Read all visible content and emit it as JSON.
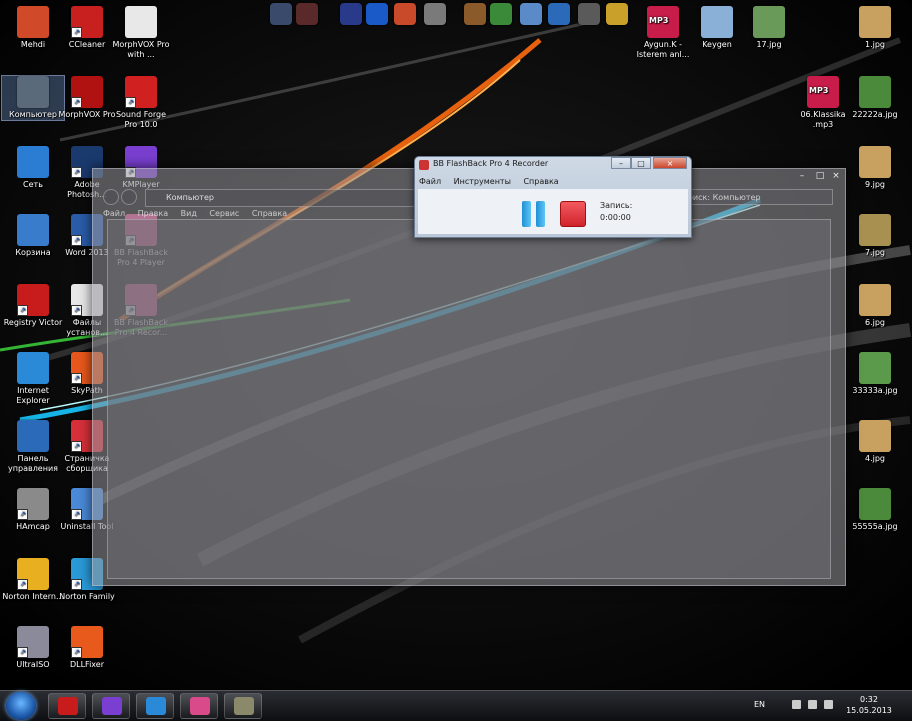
{
  "desktop": {
    "icons_left": [
      {
        "label": "Mehdi",
        "icon": "user-folder-icon",
        "color": "#d04a2a",
        "shortcut": false
      },
      {
        "label": "CCleaner",
        "icon": "ccleaner-icon",
        "color": "#c8201e",
        "shortcut": true
      },
      {
        "label": "MorphVOX Pro with ...",
        "icon": "document-icon",
        "color": "#e8e8e8",
        "shortcut": false
      },
      {
        "label": "Компьютер",
        "icon": "computer-icon",
        "color": "#5a6a7a",
        "shortcut": false,
        "selected": true
      },
      {
        "label": "MorphVOX Pro",
        "icon": "morphvox-icon",
        "color": "#b01212",
        "shortcut": true
      },
      {
        "label": "Sound Forge Pro 10.0",
        "icon": "soundforge-icon",
        "color": "#d02020",
        "shortcut": true
      },
      {
        "label": "Сеть",
        "icon": "network-icon",
        "color": "#2b7cd3",
        "shortcut": false
      },
      {
        "label": "Adobe Photosh...",
        "icon": "photoshop-icon",
        "color": "#1a3a6e",
        "shortcut": true
      },
      {
        "label": "KMPlayer",
        "icon": "kmplayer-icon",
        "color": "#7a3fd0",
        "shortcut": true
      },
      {
        "label": "Корзина",
        "icon": "recycle-bin-icon",
        "color": "#3a7ccc",
        "shortcut": false
      },
      {
        "label": "Word 2013",
        "icon": "word-icon",
        "color": "#2a5caa",
        "shortcut": true
      },
      {
        "label": "BB FlashBack Pro 4 Player",
        "icon": "flashback-player-icon",
        "color": "#d84a8a",
        "shortcut": true
      },
      {
        "label": "Registry Victor",
        "icon": "registry-icon",
        "color": "#c81c1c",
        "shortcut": true
      },
      {
        "label": "Файлы установ...",
        "icon": "files-icon",
        "color": "#e8e8e8",
        "shortcut": true
      },
      {
        "label": "BB FlashBack Pro 4 Recor...",
        "icon": "flashback-recorder-icon",
        "color": "#d84a8a",
        "shortcut": true
      },
      {
        "label": "Internet Explorer",
        "icon": "internet-explorer-icon",
        "color": "#2a8ad8",
        "shortcut": false
      },
      {
        "label": "SkyPath",
        "icon": "skypath-icon",
        "color": "#e8581c",
        "shortcut": true
      },
      {
        "label": "Панель управления",
        "icon": "control-panel-icon",
        "color": "#2a6ab8",
        "shortcut": false
      },
      {
        "label": "Страничка сборщика",
        "icon": "opera-icon",
        "color": "#d8303a",
        "shortcut": true
      },
      {
        "label": "HAmcap",
        "icon": "hamcap-icon",
        "color": "#8a8a8a",
        "shortcut": true
      },
      {
        "label": "Uninstall Tool",
        "icon": "uninstall-icon",
        "color": "#4a8ad8",
        "shortcut": true
      },
      {
        "label": "Norton Intern...",
        "icon": "norton-icon",
        "color": "#e8b020",
        "shortcut": true
      },
      {
        "label": "Norton Family",
        "icon": "norton-family-icon",
        "color": "#2a9ad8",
        "shortcut": true
      },
      {
        "label": "UltraISO",
        "icon": "ultraiso-icon",
        "color": "#8a8a9a",
        "shortcut": true
      },
      {
        "label": "DLLFixer",
        "icon": "dllfixer-icon",
        "color": "#e85a1c",
        "shortcut": true
      }
    ],
    "icons_top_right": [
      {
        "label": "Aygun.K - Isterem anl...",
        "icon": "mp3-file-icon",
        "color": "#c81c4a",
        "badge": "MP3"
      },
      {
        "label": "Keygen",
        "icon": "keygen-icon",
        "color": "#8ab0d8"
      },
      {
        "label": "17.jpg",
        "icon": "image-thumb-icon",
        "color": "#6a9a5a"
      },
      {
        "label": "1.jpg",
        "icon": "image-thumb-icon",
        "color": "#c8a060"
      }
    ],
    "icons_right": [
      {
        "label": "06.Klassika .mp3",
        "icon": "mp3-file-icon",
        "color": "#c81c4a",
        "badge": "MP3"
      },
      {
        "label": "22222a.jpg",
        "icon": "image-thumb-icon",
        "color": "#4a8a3a"
      },
      {
        "label": "9.jpg",
        "icon": "image-thumb-icon",
        "color": "#c8a060"
      },
      {
        "label": "7.jpg",
        "icon": "image-thumb-icon",
        "color": "#a89050"
      },
      {
        "label": "6.jpg",
        "icon": "image-thumb-icon",
        "color": "#c8a060"
      },
      {
        "label": "33333a.jpg",
        "icon": "image-thumb-icon",
        "color": "#5a9a4a"
      },
      {
        "label": "4.jpg",
        "icon": "image-thumb-icon",
        "color": "#c8a060"
      },
      {
        "label": "55555a.jpg",
        "icon": "image-thumb-icon",
        "color": "#4a8a3a"
      }
    ],
    "top_toolbar_icons": [
      {
        "icon": "app-icon",
        "color": "#3a4a6a"
      },
      {
        "icon": "film-icon",
        "color": "#5a2a2a"
      },
      {
        "icon": "gamepad-icon",
        "color": "#2a3a8a"
      },
      {
        "icon": "media-player-icon",
        "color": "#1a5ac8"
      },
      {
        "icon": "paint-icon",
        "color": "#c84a2a"
      },
      {
        "icon": "calculator-icon",
        "color": "#7a7a7a"
      },
      {
        "icon": "movie-maker-icon",
        "color": "#8a5a2a"
      },
      {
        "icon": "chrome-icon",
        "color": "#3a8a3a"
      },
      {
        "icon": "network-tool-icon",
        "color": "#5a8ac8"
      },
      {
        "icon": "globe-icon",
        "color": "#2a6ab8"
      },
      {
        "icon": "film-strip-icon",
        "color": "#5a5a5a"
      },
      {
        "icon": "grid-app-icon",
        "color": "#c8a02a"
      }
    ]
  },
  "explorer": {
    "address": "Компьютер",
    "search_placeholder": "Поиск: Компьютер",
    "menu": [
      "Файл",
      "Правка",
      "Вид",
      "Сервис",
      "Справка"
    ]
  },
  "recorder": {
    "title": "BB FlashBack Pro 4 Recorder",
    "menu": [
      "Файл",
      "Инструменты",
      "Справка"
    ],
    "status_label": "Запись:",
    "time": "0:00:00",
    "pause_color": "#2a9ae0",
    "stop_color": "#e0323a"
  },
  "taskbar": {
    "buttons": [
      {
        "icon": "folder-red-icon",
        "color": "#c81c1c"
      },
      {
        "icon": "kmplayer-icon",
        "color": "#7a3fd0"
      },
      {
        "icon": "internet-explorer-icon",
        "color": "#2a8ad8"
      },
      {
        "icon": "flashback-player-icon",
        "color": "#d84a8a"
      },
      {
        "icon": "archive-icon",
        "color": "#8a8a6a"
      }
    ],
    "lang": "EN",
    "time": "0:32",
    "date": "15.05.2013"
  }
}
